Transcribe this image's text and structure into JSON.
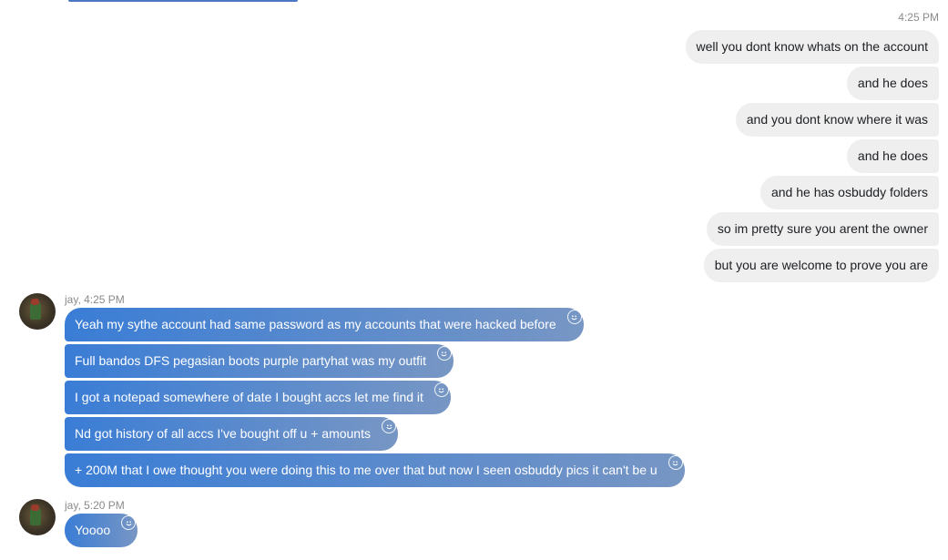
{
  "outgoing": {
    "time": "4:25 PM",
    "messages": [
      "well you dont know whats on the account",
      "and he does",
      "and you dont know where it was",
      "and he does",
      "and he has osbuddy folders",
      "so im pretty sure you arent the owner",
      "but you are welcome to prove you are"
    ]
  },
  "incoming_1": {
    "sender_time": "jay, 4:25 PM",
    "messages": [
      "Yeah my sythe account had same password as my accounts that were hacked before",
      "Full bandos DFS pegasian boots purple partyhat was my outfit",
      "I got a notepad somewhere of date I bought accs let me find it",
      "Nd got history of all accs I've bought off u + amounts",
      "+ 200M that I owe thought you were doing this to me over that but now I seen osbuddy pics it can't be u"
    ]
  },
  "incoming_2": {
    "sender_time": "jay, 5:20 PM",
    "messages": [
      "Yoooo"
    ]
  },
  "colors": {
    "incoming_start": "#3a7dd6",
    "incoming_end": "#7796c4",
    "outgoing_bg": "#efefef"
  },
  "icons": {
    "reaction": "smiley-reaction-icon"
  }
}
